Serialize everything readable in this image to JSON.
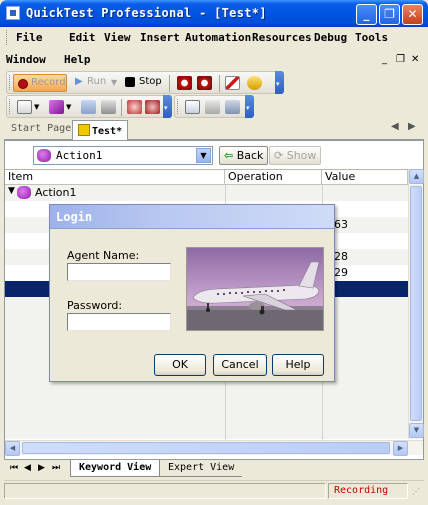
{
  "window": {
    "title": "QuickTest Professional - [Test*]",
    "minimize_glyph": "_",
    "restore_glyph": "❐",
    "close_glyph": "✕"
  },
  "menubar": {
    "row1": [
      "File",
      "Edit",
      "View",
      "Insert",
      "Automation",
      "Resources",
      "Debug",
      "Tools"
    ],
    "row2": [
      "Window",
      "Help"
    ],
    "mdi_minimize": "_",
    "mdi_restore": "❐",
    "mdi_close": "✕"
  },
  "toolbar": {
    "record_label": "Record",
    "run_label": "Run",
    "stop_label": "Stop"
  },
  "tabs": {
    "start_page": "Start Page",
    "test": "Test*"
  },
  "action_bar": {
    "selected_action": "Action1",
    "back_label": "Back",
    "show_label": "Show"
  },
  "grid": {
    "columns": [
      "Item",
      "Operation",
      "Value"
    ],
    "tree_root": "Action1",
    "value_fragments": [
      "263",
      "228",
      "229"
    ]
  },
  "bottom_tabs": {
    "keyword_view": "Keyword View",
    "expert_view": "Expert View"
  },
  "status": {
    "text": "Recording"
  },
  "dialog": {
    "title": "Login",
    "agent_name_label": "Agent Name:",
    "agent_name_value": "",
    "password_label": "Password:",
    "password_value": "",
    "ok_label": "OK",
    "cancel_label": "Cancel",
    "help_label": "Help"
  },
  "colors": {
    "title_blue": "#0054e3",
    "selection": "#0a246a",
    "recording_red": "#c00000",
    "dialog_title": "#9db2ea"
  }
}
